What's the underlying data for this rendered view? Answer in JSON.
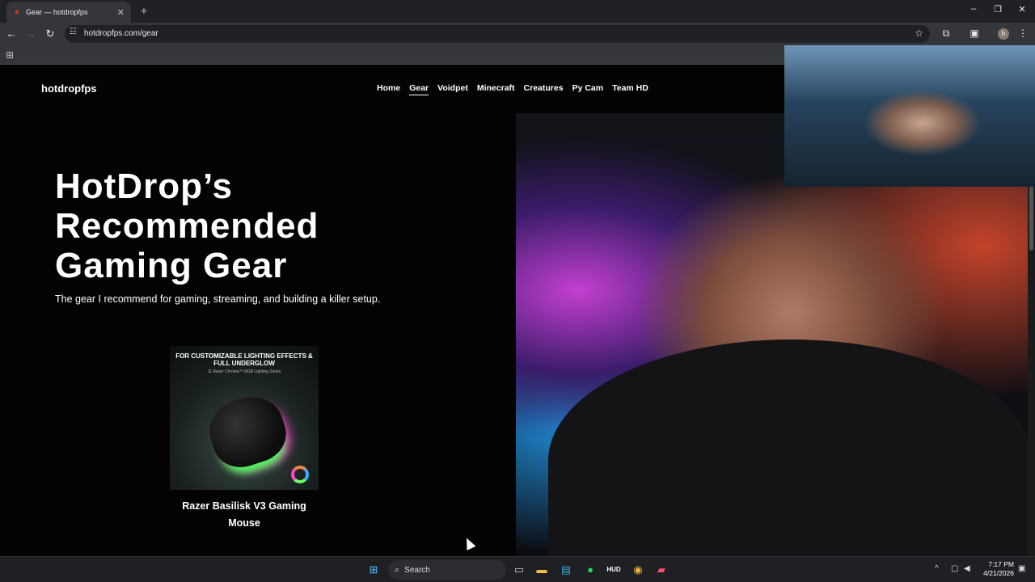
{
  "browser": {
    "tab_title": "Gear — hotdropfps",
    "url": "hotdropfps.com/gear",
    "profile_initial": "h"
  },
  "site": {
    "logo": "hotdropfps",
    "nav": [
      "Home",
      "Gear",
      "Voidpet",
      "Minecraft",
      "Creatures",
      "Py Cam",
      "Team HD"
    ],
    "active_nav": "Gear",
    "hero_title": "HotDrop’s Recommended Gaming Gear",
    "hero_subtitle": "The gear I recommend for gaming, streaming, and building a killer setup.",
    "product": {
      "image_caption": "FOR CUSTOMIZABLE LIGHTING EFFECTS & FULL UNDERGLOW",
      "image_subcaption": "11 Razer Chroma™ RGB Lighting Zones",
      "name": "Razer Basilisk V3 Gaming Mouse"
    }
  },
  "taskbar": {
    "search_placeholder": "Search",
    "time": "7:17 PM",
    "date": "4/21/2026"
  }
}
